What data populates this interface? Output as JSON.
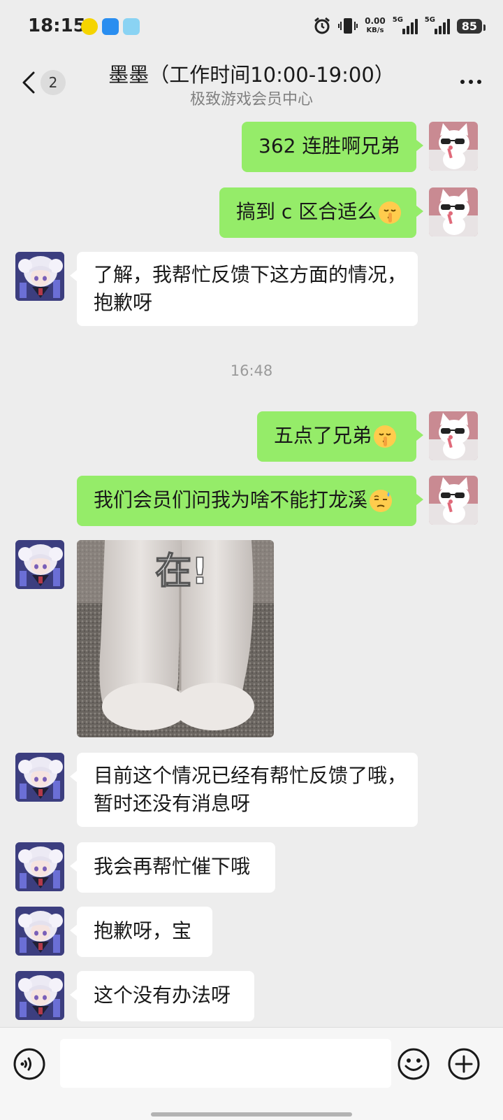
{
  "status_bar": {
    "time": "18:15",
    "net_speed_value": "0.00",
    "net_speed_unit": "KB/s",
    "signal1_label": "5G",
    "signal2_label": "5G",
    "battery": "85",
    "icons": [
      "app-qq-music-icon",
      "app-browser-icon",
      "app-hand-icon",
      "alarm-icon",
      "vibrate-icon"
    ]
  },
  "header": {
    "unread_count": "2",
    "title": "墨墨（工作时间10:00-19:00）",
    "subtitle": "极致游戏会员中心"
  },
  "messages": [
    {
      "side": "out",
      "text": "362 连胜啊兄弟"
    },
    {
      "side": "out",
      "text": "搞到 c 区合适么",
      "emoji": "shushing-face"
    },
    {
      "side": "in",
      "lines": [
        "了解，我帮忙反馈下这方面的情况，",
        "抱歉呀"
      ]
    },
    {
      "timestamp": "16:48"
    },
    {
      "side": "out",
      "text": "五点了兄弟",
      "emoji": "shushing-face"
    },
    {
      "side": "out",
      "text": "我们会员们问我为啥不能打龙溪",
      "emoji": "sweat-face"
    },
    {
      "side": "in",
      "sticker": "cat-paws",
      "sticker_text": "在!"
    },
    {
      "side": "in",
      "lines": [
        "目前这个情况已经有帮忙反馈了哦，",
        "暂时还没有消息呀"
      ]
    },
    {
      "side": "in",
      "text": "我会再帮忙催下哦"
    },
    {
      "side": "in",
      "text": "抱歉呀，宝"
    },
    {
      "side": "in",
      "text": "这个没有办法呀"
    }
  ],
  "colors": {
    "outgoing_bubble": "#95ec69",
    "incoming_bubble": "#ffffff",
    "background": "#ededed"
  }
}
